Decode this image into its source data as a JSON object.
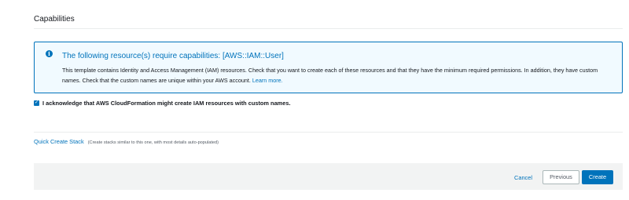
{
  "capabilities": {
    "title": "Capabilities",
    "alert": {
      "icon": "info-icon",
      "icon_glyph": "i",
      "title": "The following resource(s) require capabilities: [AWS::IAM::User]",
      "body": "This template contains Identity and Access Management (IAM) resources. Check that you want to create each of these resources and that they have the minimum required permissions. In addition, they have custom names. Check that the custom names are unique within your AWS account.",
      "learn_more": "Learn more."
    },
    "acknowledge": {
      "checked": true,
      "check_glyph": "✓",
      "label": "I acknowledge that AWS CloudFormation might create IAM resources with custom names."
    }
  },
  "quick_create": {
    "link": "Quick Create Stack",
    "note": "(Create stacks similar to this one, with most details auto-populated)"
  },
  "footer": {
    "cancel": "Cancel",
    "previous": "Previous",
    "create": "Create"
  },
  "colors": {
    "accent": "#0073bb",
    "alert_bg": "#f1faff",
    "footer_bg": "#f2f3f3"
  }
}
